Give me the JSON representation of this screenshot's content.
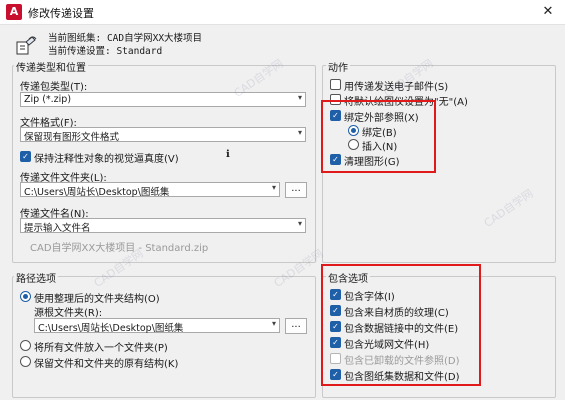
{
  "window": {
    "title": "修改传递设置",
    "app_icon": "A",
    "close_glyph": "✕"
  },
  "info": {
    "sheet_set": "当前图纸集: CAD自学网XX大楼项目",
    "transmittal_setup": "当前传递设置: Standard"
  },
  "package": {
    "group_label": "传递类型和位置",
    "type_label": "传递包类型(T):",
    "type_value": "Zip (*.zip)",
    "format_label": "文件格式(F):",
    "format_value": "保留现有图形文件格式",
    "fidelity_label": "保持注释性对象的视觉逼真度(V)",
    "fidelity_checked": true,
    "info_glyph": "ℹ",
    "folder_label": "传递文件文件夹(L):",
    "folder_value": "C:\\Users\\周站长\\Desktop\\图纸集",
    "browse_label": "...",
    "filename_label": "传递文件名(N):",
    "filename_value": "提示输入文件名",
    "filename_preview": "CAD自学网XX大楼项目 - Standard.zip"
  },
  "actions": {
    "group_label": "动作",
    "send_email": "用传递发送电子邮件(S)",
    "set_default_plotter": "将默认绘图仪设置为\"无\"(A)",
    "bind_xref": "绑定外部参照(X)",
    "bind": "绑定(B)",
    "insert": "插入(N)",
    "purge": "清理图形(G)"
  },
  "path": {
    "group_label": "路径选项",
    "organized": "使用整理后的文件夹结构(O)",
    "source_root_label": "源根文件夹(R):",
    "source_root_value": "C:\\Users\\周站长\\Desktop\\图纸集",
    "browse_label": "...",
    "all_in_one": "将所有文件放入一个文件夹(P)",
    "keep_structure": "保留文件和文件夹的原有结构(K)"
  },
  "include": {
    "group_label": "包含选项",
    "fonts": "包含字体(I)",
    "textures": "包含来自材质的纹理(C)",
    "data_links": "包含数据链接中的文件(E)",
    "photometric": "包含光域网文件(H)",
    "unloaded_xrefs": "包含已卸载的文件参照(D)",
    "sheet_set_data": "包含图纸集数据和文件(D)"
  },
  "watermark": "CAD自学网",
  "colors": {
    "accent": "#1e5fa8",
    "highlight_box": "#e0191b",
    "app_brand": "#c8102e"
  }
}
